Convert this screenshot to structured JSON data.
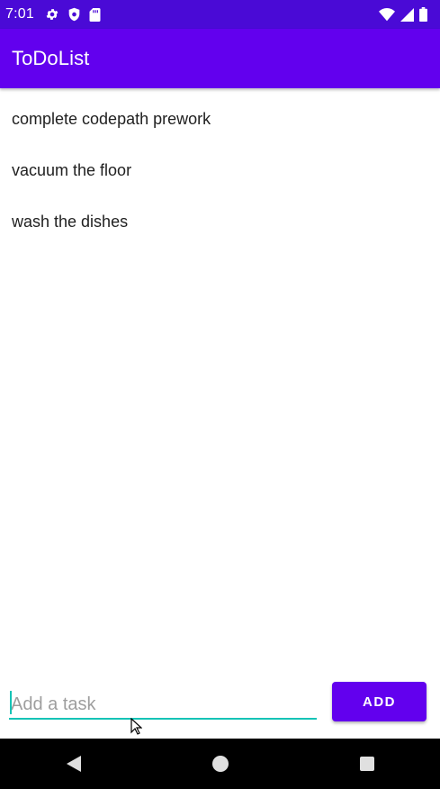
{
  "status_bar": {
    "time": "7:01",
    "left_icons": [
      "gear-icon",
      "shield-icon",
      "sd-card-icon"
    ],
    "right_icons": [
      "wifi-icon",
      "signal-icon",
      "battery-icon"
    ]
  },
  "app_bar": {
    "title": "ToDoList",
    "color": "#6200ee"
  },
  "tasks": [
    {
      "label": "complete codepath prework"
    },
    {
      "label": "vacuum the floor"
    },
    {
      "label": "wash the dishes"
    }
  ],
  "input": {
    "placeholder": "Add a task",
    "value": "",
    "accent": "#15c3b6"
  },
  "add_button": {
    "label": "ADD"
  },
  "nav_bar": {
    "buttons": [
      "back-icon",
      "home-icon",
      "recents-icon"
    ]
  }
}
